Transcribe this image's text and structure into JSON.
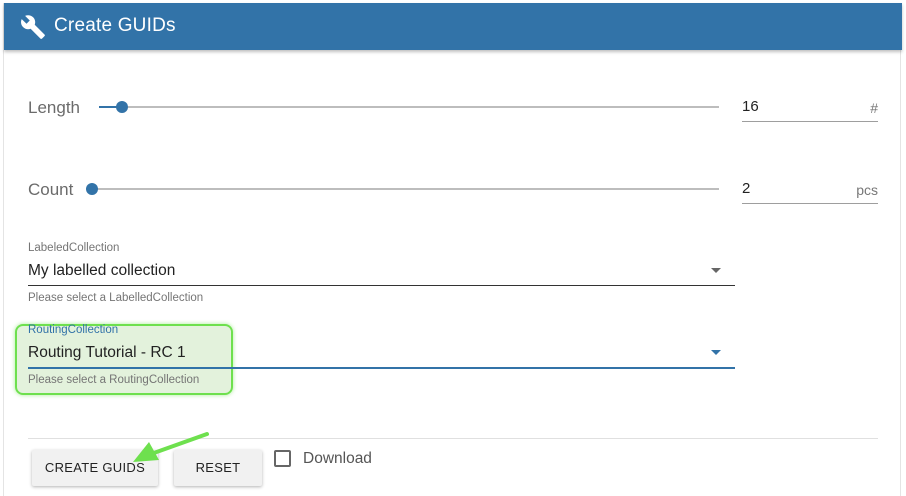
{
  "header": {
    "title": "Create GUIDs",
    "icon": "wrench-icon",
    "bg_color": "#3273a8"
  },
  "length": {
    "label": "Length",
    "value": "16",
    "unit": "#",
    "slider_fraction": 0.04
  },
  "count": {
    "label": "Count",
    "value": "2",
    "unit": "pcs",
    "slider_fraction": 0.0
  },
  "labeled_collection": {
    "label": "LabeledCollection",
    "value": "My labelled collection",
    "helper": "Please select a LabelledCollection"
  },
  "routing_collection": {
    "label": "RoutingCollection",
    "value": "Routing Tutorial - RC 1",
    "helper": "Please select a RoutingCollection"
  },
  "actions": {
    "create_label": "CREATE GUIDS",
    "reset_label": "RESET",
    "download_label": "Download",
    "download_checked": false
  },
  "annotation": {
    "highlight_color": "#6ee04e",
    "arrow_target": "create-guids-button"
  }
}
